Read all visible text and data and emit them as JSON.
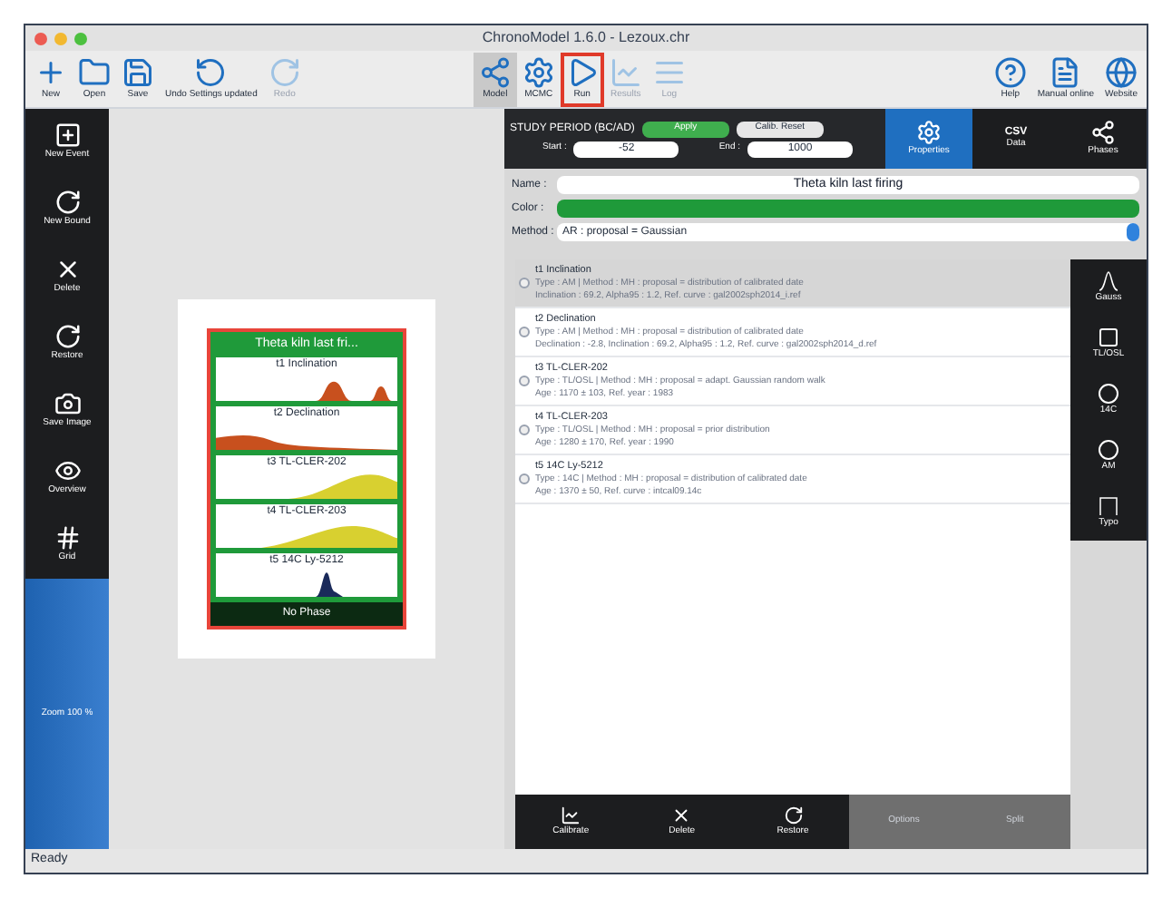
{
  "window": {
    "title": "ChronoModel 1.6.0 - Lezoux.chr"
  },
  "toolbar": [
    {
      "label": "New",
      "disabled": false,
      "selected": false,
      "highlighted": false
    },
    {
      "label": "Open",
      "disabled": false,
      "selected": false,
      "highlighted": false
    },
    {
      "label": "Save",
      "disabled": false,
      "selected": false,
      "highlighted": false
    },
    {
      "label": "Undo Settings updated",
      "disabled": false,
      "selected": false,
      "highlighted": false
    },
    {
      "label": "Redo",
      "disabled": true,
      "selected": false,
      "highlighted": false
    },
    {
      "label": "Model",
      "disabled": false,
      "selected": true,
      "highlighted": false
    },
    {
      "label": "MCMC",
      "disabled": false,
      "selected": false,
      "highlighted": false
    },
    {
      "label": "Run",
      "disabled": false,
      "selected": false,
      "highlighted": true
    },
    {
      "label": "Results",
      "disabled": true,
      "selected": false,
      "highlighted": false
    },
    {
      "label": "Log",
      "disabled": true,
      "selected": false,
      "highlighted": false
    },
    {
      "label": "Help",
      "disabled": false,
      "selected": false,
      "highlighted": false
    },
    {
      "label": "Manual online",
      "disabled": false,
      "selected": false,
      "highlighted": false
    },
    {
      "label": "Website",
      "disabled": false,
      "selected": false,
      "highlighted": false
    }
  ],
  "left_tools": [
    {
      "label": "New Event"
    },
    {
      "label": "New Bound"
    },
    {
      "label": "Delete"
    },
    {
      "label": "Restore"
    },
    {
      "label": "Save Image"
    },
    {
      "label": "Overview"
    },
    {
      "label": "Grid"
    }
  ],
  "zoom_label": "Zoom 100 %",
  "event_card": {
    "title": "Theta kiln last fri...",
    "phase": "No Phase",
    "data": [
      {
        "label": "t1 Inclination",
        "color": "#c8501e",
        "kind": "peaks"
      },
      {
        "label": "t2 Declination",
        "color": "#c8501e",
        "kind": "spread"
      },
      {
        "label": "t3 TL-CLER-202",
        "color": "#d8d030",
        "kind": "rise"
      },
      {
        "label": "t4 TL-CLER-203",
        "color": "#d8d030",
        "kind": "hill"
      },
      {
        "label": "t5 14C Ly-5212",
        "color": "#1a2a5a",
        "kind": "spike"
      }
    ]
  },
  "study_period": {
    "title": "STUDY PERIOD (BC/AD)",
    "apply": "Apply",
    "calib_reset": "Calib. Reset",
    "start_label": "Start :",
    "start": "-52",
    "end_label": "End :",
    "end": "1000"
  },
  "panel_tabs": [
    {
      "label": "Properties",
      "selected": true
    },
    {
      "label": "Data",
      "selected": false
    },
    {
      "label": "Phases",
      "selected": false
    }
  ],
  "csv_label": "CSV",
  "properties": {
    "name_label": "Name :",
    "name": "Theta kiln last firing",
    "color_label": "Color :",
    "color": "#1f9a3a",
    "method_label": "Method :",
    "method": "AR : proposal = Gaussian"
  },
  "data_list": [
    {
      "title": "t1 Inclination",
      "line1": "Type : AM | Method : MH : proposal = distribution of calibrated date",
      "line2": "Inclination : 69.2, Alpha95 : 1.2, Ref. curve : gal2002sph2014_i.ref",
      "selected": true
    },
    {
      "title": "t2 Declination",
      "line1": "Type : AM | Method : MH : proposal = distribution of calibrated date",
      "line2": "Declination : -2.8, Inclination : 69.2, Alpha95 : 1.2, Ref. curve : gal2002sph2014_d.ref",
      "selected": false
    },
    {
      "title": "t3 TL-CLER-202",
      "line1": "Type : TL/OSL | Method : MH : proposal = adapt. Gaussian random walk",
      "line2": "Age : 1170 ± 103, Ref. year : 1983",
      "selected": false
    },
    {
      "title": "t4 TL-CLER-203",
      "line1": "Type : TL/OSL | Method : MH : proposal = prior distribution",
      "line2": "Age : 1280 ± 170, Ref. year : 1990",
      "selected": false
    },
    {
      "title": "t5 14C Ly-5212",
      "line1": "Type : 14C | Method : MH : proposal = distribution of calibrated date",
      "line2": "Age : 1370 ± 50, Ref. curve : intcal09.14c",
      "selected": false
    }
  ],
  "data_tools": [
    {
      "label": "Gauss"
    },
    {
      "label": "TL/OSL"
    },
    {
      "label": "14C"
    },
    {
      "label": "AM"
    },
    {
      "label": "Typo"
    }
  ],
  "bottom_tools": [
    {
      "label": "Calibrate",
      "disabled": false
    },
    {
      "label": "Delete",
      "disabled": false
    },
    {
      "label": "Restore",
      "disabled": false
    },
    {
      "label": "Options",
      "disabled": true
    },
    {
      "label": "Split",
      "disabled": true
    }
  ],
  "status_bar": "Ready"
}
